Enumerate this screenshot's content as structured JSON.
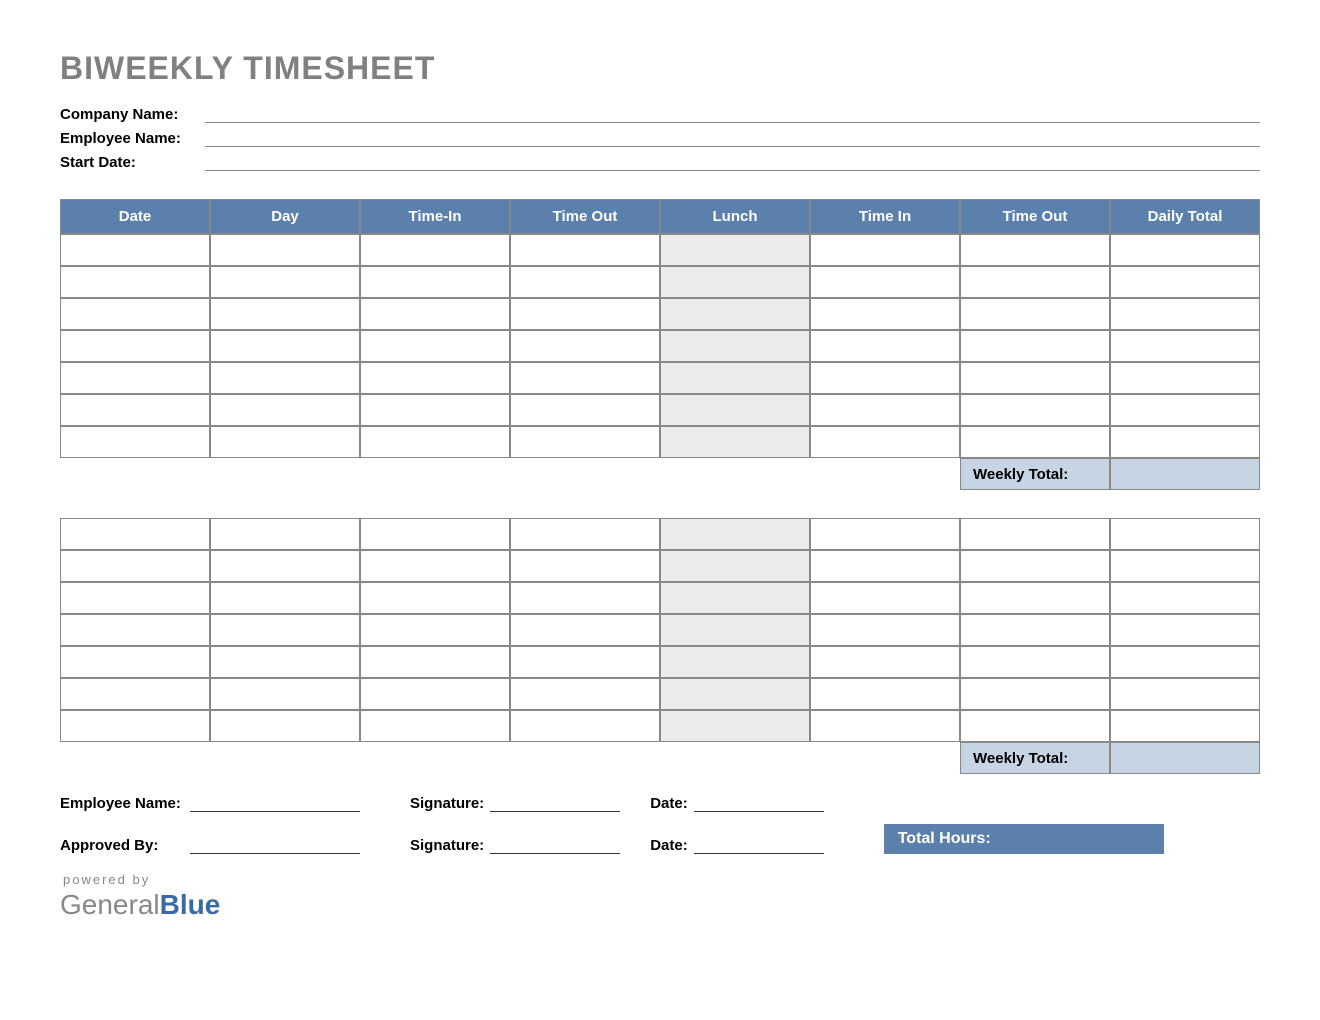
{
  "title": "BIWEEKLY TIMESHEET",
  "info": {
    "company_label": "Company Name:",
    "employee_label": "Employee Name:",
    "start_date_label": "Start Date:",
    "company_value": "",
    "employee_value": "",
    "start_date_value": ""
  },
  "columns": {
    "date": "Date",
    "day": "Day",
    "time_in1": "Time-In",
    "time_out1": "Time Out",
    "lunch": "Lunch",
    "time_in2": "Time In",
    "time_out2": "Time Out",
    "daily_total": "Daily Total"
  },
  "week1_rows": [
    {
      "date": "",
      "day": "",
      "in1": "",
      "out1": "",
      "lunch": "",
      "in2": "",
      "out2": "",
      "total": ""
    },
    {
      "date": "",
      "day": "",
      "in1": "",
      "out1": "",
      "lunch": "",
      "in2": "",
      "out2": "",
      "total": ""
    },
    {
      "date": "",
      "day": "",
      "in1": "",
      "out1": "",
      "lunch": "",
      "in2": "",
      "out2": "",
      "total": ""
    },
    {
      "date": "",
      "day": "",
      "in1": "",
      "out1": "",
      "lunch": "",
      "in2": "",
      "out2": "",
      "total": ""
    },
    {
      "date": "",
      "day": "",
      "in1": "",
      "out1": "",
      "lunch": "",
      "in2": "",
      "out2": "",
      "total": ""
    },
    {
      "date": "",
      "day": "",
      "in1": "",
      "out1": "",
      "lunch": "",
      "in2": "",
      "out2": "",
      "total": ""
    },
    {
      "date": "",
      "day": "",
      "in1": "",
      "out1": "",
      "lunch": "",
      "in2": "",
      "out2": "",
      "total": ""
    }
  ],
  "week2_rows": [
    {
      "date": "",
      "day": "",
      "in1": "",
      "out1": "",
      "lunch": "",
      "in2": "",
      "out2": "",
      "total": ""
    },
    {
      "date": "",
      "day": "",
      "in1": "",
      "out1": "",
      "lunch": "",
      "in2": "",
      "out2": "",
      "total": ""
    },
    {
      "date": "",
      "day": "",
      "in1": "",
      "out1": "",
      "lunch": "",
      "in2": "",
      "out2": "",
      "total": ""
    },
    {
      "date": "",
      "day": "",
      "in1": "",
      "out1": "",
      "lunch": "",
      "in2": "",
      "out2": "",
      "total": ""
    },
    {
      "date": "",
      "day": "",
      "in1": "",
      "out1": "",
      "lunch": "",
      "in2": "",
      "out2": "",
      "total": ""
    },
    {
      "date": "",
      "day": "",
      "in1": "",
      "out1": "",
      "lunch": "",
      "in2": "",
      "out2": "",
      "total": ""
    },
    {
      "date": "",
      "day": "",
      "in1": "",
      "out1": "",
      "lunch": "",
      "in2": "",
      "out2": "",
      "total": ""
    }
  ],
  "weekly_total_label": "Weekly Total:",
  "week1_total": "",
  "week2_total": "",
  "signatures": {
    "employee_name_label": "Employee Name:",
    "signature_label": "Signature:",
    "date_label": "Date:",
    "approved_by_label": "Approved By:",
    "employee_name_value": "",
    "employee_signature_value": "",
    "employee_date_value": "",
    "approved_by_value": "",
    "approver_signature_value": "",
    "approver_date_value": ""
  },
  "total_hours_label": "Total Hours:",
  "total_hours_value": "",
  "footer": {
    "powered": "powered by",
    "logo_1": "General",
    "logo_2": "Blue"
  }
}
